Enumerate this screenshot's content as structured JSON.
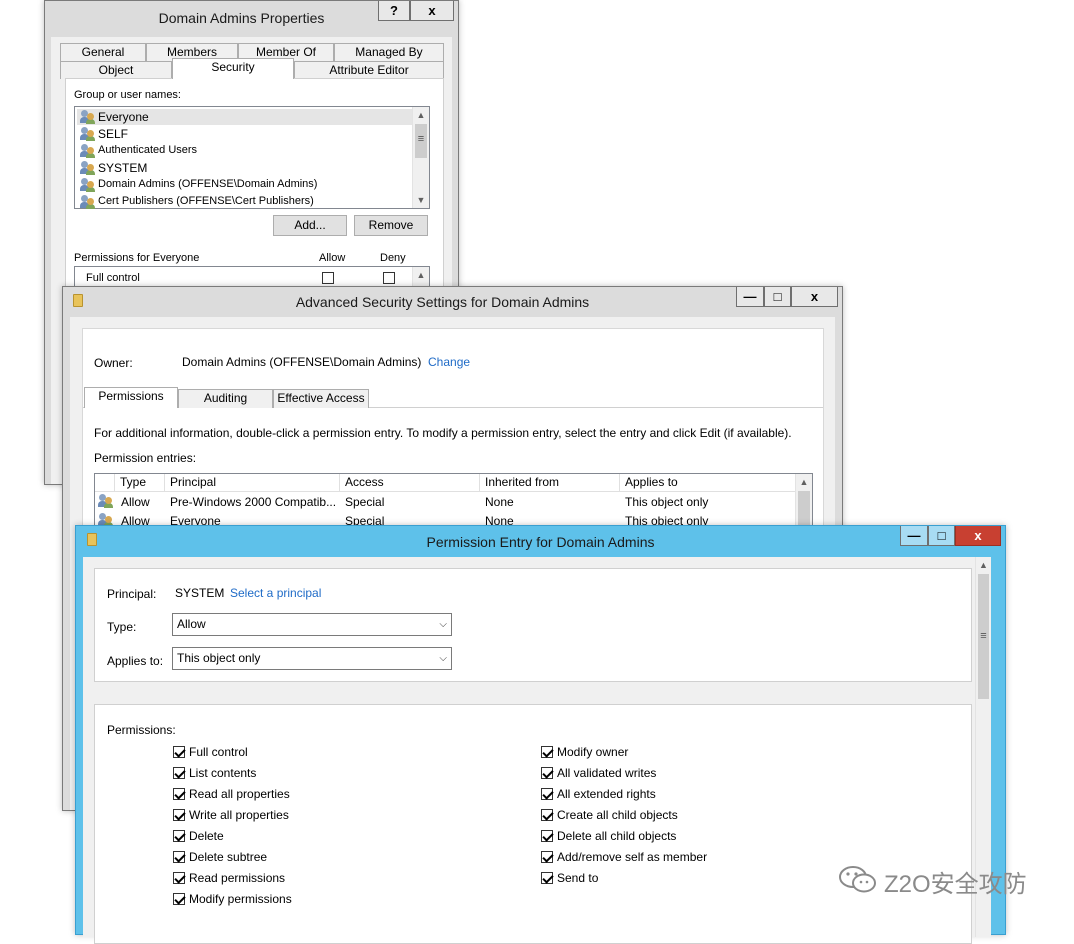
{
  "properties_window": {
    "title": "Domain Admins Properties",
    "help_btn": "?",
    "close_btn": "x",
    "tabs_row1": [
      "General",
      "Members",
      "Member Of",
      "Managed By"
    ],
    "tabs_row2": [
      "Object",
      "Security",
      "Attribute Editor"
    ],
    "group_label": "Group or user names:",
    "users": [
      "Everyone",
      "SELF",
      "Authenticated Users",
      "SYSTEM",
      "Domain Admins (OFFENSE\\Domain Admins)",
      "Cert Publishers (OFFENSE\\Cert Publishers)"
    ],
    "add_button": "Add...",
    "remove_button": "Remove",
    "permissions_for": "Permissions for Everyone",
    "allow_header": "Allow",
    "deny_header": "Deny",
    "perm_rows": [
      "Full control"
    ]
  },
  "advanced_window": {
    "title": "Advanced Security Settings for Domain Admins",
    "min_btn": "—",
    "max_btn": "□",
    "close_btn": "x",
    "owner_label": "Owner:",
    "owner_value": "Domain Admins (OFFENSE\\Domain Admins)",
    "owner_change": "Change",
    "tabs": [
      "Permissions",
      "Auditing",
      "Effective Access"
    ],
    "info": "For additional information, double-click a permission entry. To modify a permission entry, select the entry and click Edit (if available).",
    "entries_label": "Permission entries:",
    "columns": [
      "Type",
      "Principal",
      "Access",
      "Inherited from",
      "Applies to"
    ],
    "rows": [
      {
        "type": "Allow",
        "principal": "Pre-Windows 2000 Compatib...",
        "access": "Special",
        "inherited": "None",
        "applies": "This object only"
      },
      {
        "type": "Allow",
        "principal": "Everyone",
        "access": "Special",
        "inherited": "None",
        "applies": "This object only"
      }
    ]
  },
  "entry_window": {
    "title": "Permission Entry for Domain Admins",
    "min_btn": "—",
    "max_btn": "□",
    "close_btn": "x",
    "principal_label": "Principal:",
    "principal_value": "SYSTEM",
    "principal_link": "Select a principal",
    "type_label": "Type:",
    "type_value": "Allow",
    "applies_label": "Applies to:",
    "applies_value": "This object only",
    "permissions_label": "Permissions:",
    "perms_left": [
      "Full control",
      "List contents",
      "Read all properties",
      "Write all properties",
      "Delete",
      "Delete subtree",
      "Read permissions",
      "Modify permissions"
    ],
    "perms_right": [
      "Modify owner",
      "All validated writes",
      "All extended rights",
      "Create all child objects",
      "Delete all child objects",
      "Add/remove self as member",
      "Send to"
    ]
  },
  "watermark": "Z2O安全攻防"
}
